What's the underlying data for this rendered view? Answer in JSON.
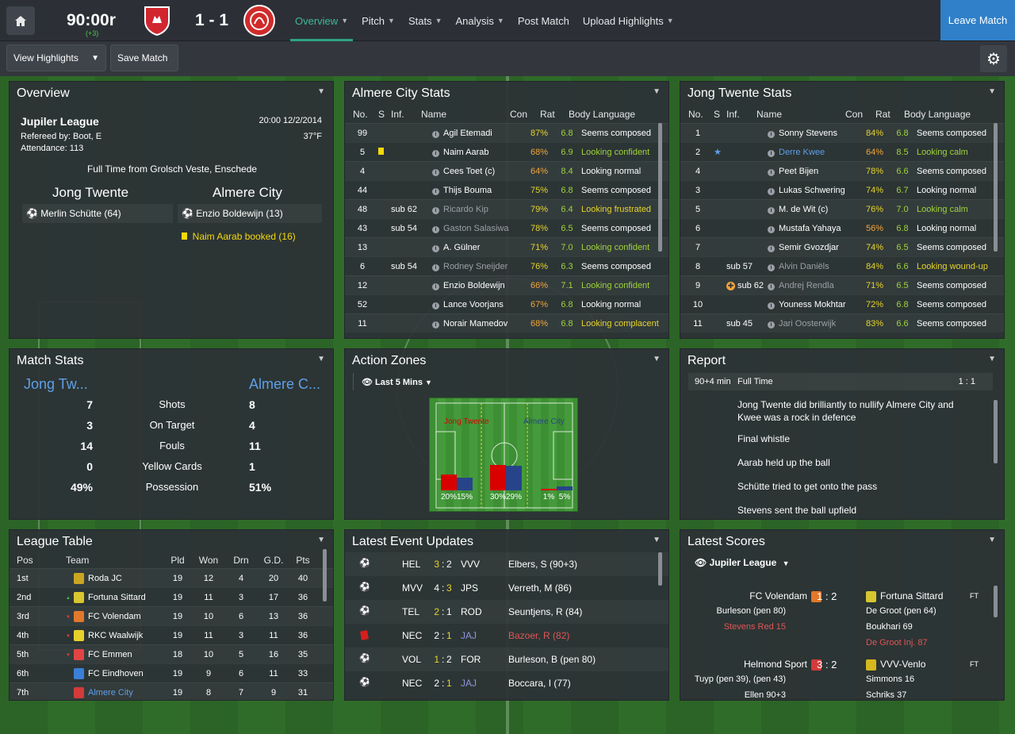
{
  "topbar": {
    "clock": "90:00r",
    "added_time": "(+3)",
    "score": "1 - 1",
    "home_color": "#d2262f",
    "away_color": "#d02b2b",
    "nav": [
      {
        "label": "Overview",
        "active": true
      },
      {
        "label": "Pitch"
      },
      {
        "label": "Stats"
      },
      {
        "label": "Analysis"
      },
      {
        "label": "Post Match"
      },
      {
        "label": "Upload Highlights"
      }
    ],
    "leave_label": "Leave Match"
  },
  "toolbar": {
    "highlights_label": "View Highlights",
    "save_label": "Save Match"
  },
  "overview": {
    "title": "Overview",
    "competition": "Jupiler League",
    "datetime": "20:00 12/2/2014",
    "referee": "Refereed by: Boot, E",
    "temperature": "37°F",
    "attendance": "Attendance: 113",
    "status": "Full Time from Grolsch Veste, Enschede",
    "home": "Jong Twente",
    "away": "Almere City",
    "home_events": [
      "Merlin Schütte (64)"
    ],
    "away_events": [
      "Enzio Boldewijn (13)",
      "Naim Aarab booked (16)"
    ]
  },
  "almere_stats": {
    "title": "Almere City Stats",
    "headers": [
      "No.",
      "S",
      "Inf.",
      "Name",
      "Con",
      "Rat",
      "Body Language"
    ],
    "rows": [
      {
        "no": "99",
        "inf": "",
        "name": "Agil Etemadi",
        "con": "87%",
        "rat": "6.8",
        "body": "Seems composed"
      },
      {
        "no": "5",
        "inf": "",
        "yellow": true,
        "name": "Naim Aarab",
        "con": "68%",
        "rat": "6.9",
        "body": "Looking confident"
      },
      {
        "no": "4",
        "inf": "",
        "name": "Cees Toet (c)",
        "con": "64%",
        "rat": "8.4",
        "body": "Looking normal"
      },
      {
        "no": "44",
        "inf": "",
        "name": "Thijs Bouma",
        "con": "75%",
        "rat": "6.8",
        "body": "Seems composed"
      },
      {
        "no": "48",
        "inf": "sub 62",
        "name": "Ricardo Kip",
        "con": "79%",
        "rat": "6.4",
        "body": "Looking frustrated"
      },
      {
        "no": "43",
        "inf": "sub 54",
        "name": "Gaston Salasiwa",
        "con": "78%",
        "rat": "6.5",
        "body": "Seems composed"
      },
      {
        "no": "13",
        "inf": "",
        "name": "A. Gülner",
        "con": "71%",
        "rat": "7.0",
        "body": "Looking confident"
      },
      {
        "no": "6",
        "inf": "sub 54",
        "name": "Rodney Sneijder",
        "con": "76%",
        "rat": "6.3",
        "body": "Seems composed"
      },
      {
        "no": "12",
        "inf": "",
        "name": "Enzio Boldewijn",
        "con": "66%",
        "rat": "7.1",
        "body": "Looking confident"
      },
      {
        "no": "52",
        "inf": "",
        "name": "Lance Voorjans",
        "con": "67%",
        "rat": "6.8",
        "body": "Looking normal"
      },
      {
        "no": "11",
        "inf": "",
        "name": "Norair Mamedov",
        "con": "68%",
        "rat": "6.8",
        "body": "Looking complacent"
      }
    ]
  },
  "twente_stats": {
    "title": "Jong Twente Stats",
    "headers": [
      "No.",
      "S",
      "Inf.",
      "Name",
      "Con",
      "Rat",
      "Body Language"
    ],
    "rows": [
      {
        "no": "1",
        "inf": "",
        "name": "Sonny Stevens",
        "con": "84%",
        "rat": "6.8",
        "body": "Seems composed"
      },
      {
        "no": "2",
        "inf": "",
        "star": true,
        "name": "Derre Kwee",
        "con": "64%",
        "rat": "8.5",
        "body": "Looking calm"
      },
      {
        "no": "4",
        "inf": "",
        "name": "Peet Bijen",
        "con": "78%",
        "rat": "6.6",
        "body": "Seems composed"
      },
      {
        "no": "3",
        "inf": "",
        "name": "Lukas Schwering",
        "con": "74%",
        "rat": "6.7",
        "body": "Looking normal"
      },
      {
        "no": "5",
        "inf": "",
        "name": "M. de Wit (c)",
        "con": "76%",
        "rat": "7.0",
        "body": "Looking calm"
      },
      {
        "no": "6",
        "inf": "",
        "name": "Mustafa Yahaya",
        "con": "56%",
        "rat": "6.8",
        "body": "Looking normal"
      },
      {
        "no": "7",
        "inf": "",
        "name": "Semir Gvozdjar",
        "con": "74%",
        "rat": "6.5",
        "body": "Seems composed"
      },
      {
        "no": "8",
        "inf": "sub 57",
        "name": "Alvin Daniëls",
        "con": "84%",
        "rat": "6.6",
        "body": "Looking wound-up"
      },
      {
        "no": "9",
        "inf": "sub 62",
        "injury": true,
        "name": "Andrej Rendla",
        "con": "71%",
        "rat": "6.5",
        "body": "Seems composed"
      },
      {
        "no": "10",
        "inf": "",
        "name": "Youness Mokhtar",
        "con": "72%",
        "rat": "6.8",
        "body": "Seems composed"
      },
      {
        "no": "11",
        "inf": "sub 45",
        "name": "Jari Oosterwijk",
        "con": "83%",
        "rat": "6.6",
        "body": "Seems composed"
      }
    ]
  },
  "match_stats": {
    "title": "Match Stats",
    "home": "Jong Tw...",
    "away": "Almere C...",
    "rows": [
      {
        "label": "Shots",
        "home": "7",
        "away": "8"
      },
      {
        "label": "On Target",
        "home": "3",
        "away": "4"
      },
      {
        "label": "Fouls",
        "home": "14",
        "away": "11"
      },
      {
        "label": "Yellow Cards",
        "home": "0",
        "away": "1"
      },
      {
        "label": "Possession",
        "home": "49%",
        "away": "51%"
      }
    ]
  },
  "action_zones": {
    "title": "Action Zones",
    "filter": "Last 5 Mins",
    "home": "Jong Twente",
    "away": "Almere City",
    "home_color": "#d90000",
    "away_color": "#27448a",
    "zones": [
      {
        "home": 20,
        "away": 15
      },
      {
        "home": 30,
        "away": 29
      },
      {
        "home": 1,
        "away": 5
      }
    ],
    "labels": [
      "20%",
      "15%",
      "30%",
      "29%",
      "1%",
      "5%"
    ]
  },
  "report": {
    "title": "Report",
    "time": "90+4 min",
    "event": "Full Time",
    "score": "1 : 1",
    "lines": [
      "Jong Twente did brilliantly to nullify Almere City and Kwee was a rock in defence",
      "Final whistle",
      "Aarab held up the ball",
      "Schütte tried to get onto the pass",
      "Stevens sent the ball upfield"
    ]
  },
  "league_table": {
    "title": "League Table",
    "headers": [
      "Pos",
      "Team",
      "Pld",
      "Won",
      "Drn",
      "G.D.",
      "Pts"
    ],
    "rows": [
      {
        "pos": "1st",
        "move": "",
        "team": "Roda JC",
        "badge": "#c9a522",
        "pld": "19",
        "won": "12",
        "drn": "4",
        "gd": "20",
        "pts": "40"
      },
      {
        "pos": "2nd",
        "move": "up",
        "team": "Fortuna Sittard",
        "badge": "#d7c62f",
        "pld": "19",
        "won": "11",
        "drn": "3",
        "gd": "17",
        "pts": "36"
      },
      {
        "pos": "3rd",
        "move": "down",
        "team": "FC Volendam",
        "badge": "#e2782b",
        "pld": "19",
        "won": "10",
        "drn": "6",
        "gd": "13",
        "pts": "36"
      },
      {
        "pos": "4th",
        "move": "down",
        "team": "RKC Waalwijk",
        "badge": "#e8d02a",
        "pld": "19",
        "won": "11",
        "drn": "3",
        "gd": "11",
        "pts": "36"
      },
      {
        "pos": "5th",
        "move": "down",
        "team": "FC Emmen",
        "badge": "#e24444",
        "pld": "18",
        "won": "10",
        "drn": "5",
        "gd": "16",
        "pts": "35"
      },
      {
        "pos": "6th",
        "move": "",
        "team": "FC Eindhoven",
        "badge": "#3a7fd8",
        "pld": "19",
        "won": "9",
        "drn": "6",
        "gd": "11",
        "pts": "33"
      },
      {
        "pos": "7th",
        "move": "",
        "team": "Almere City",
        "badge": "#d33a3a",
        "pld": "19",
        "won": "8",
        "drn": "7",
        "gd": "9",
        "pts": "31"
      }
    ]
  },
  "events": {
    "title": "Latest Event Updates",
    "rows": [
      {
        "icon": "ball",
        "home": "HEL",
        "hs": "3",
        "as": "2",
        "hl": "home",
        "away": "VVV",
        "detail": "Elbers, S (90+3)",
        "red": false
      },
      {
        "icon": "ball",
        "home": "MVV",
        "hs": "4",
        "as": "3",
        "hl": "away",
        "away": "JPS",
        "detail": "Verreth, M (86)",
        "red": false
      },
      {
        "icon": "ball",
        "home": "TEL",
        "hs": "2",
        "as": "1",
        "hl": "home",
        "away": "ROD",
        "detail": "Seuntjens, R (84)",
        "red": false
      },
      {
        "icon": "red",
        "home": "NEC",
        "hs": "2",
        "as": "1",
        "hl": "away",
        "away": "JAJ",
        "detail": "Bazoer, R (82)",
        "red": true
      },
      {
        "icon": "ball",
        "home": "VOL",
        "hs": "1",
        "as": "2",
        "hl": "home",
        "away": "FOR",
        "detail": "Burleson, B (pen 80)",
        "red": false
      },
      {
        "icon": "ball",
        "home": "NEC",
        "hs": "2",
        "as": "1",
        "hl": "away",
        "away": "JAJ",
        "detail": "Boccara, I (77)",
        "red": false
      }
    ]
  },
  "scores": {
    "title": "Latest Scores",
    "filter": "Jupiler League",
    "matches": [
      {
        "home": "FC Volendam",
        "home_badge": "#e2782b",
        "score": "1 : 2",
        "away": "Fortuna Sittard",
        "away_badge": "#d7c62f",
        "status": "FT",
        "home_notes": [
          {
            "text": "Burleson (pen 80)",
            "red": false
          },
          {
            "text": "Stevens Red 15",
            "red": true
          }
        ],
        "away_notes": [
          {
            "text": "De Groot (pen 64)",
            "red": false
          },
          {
            "text": "Boukhari 69",
            "red": false
          },
          {
            "text": "De Groot Inj. 87",
            "red": true
          }
        ]
      },
      {
        "home": "Helmond Sport",
        "home_badge": "#d33a3a",
        "score": "3 : 2",
        "away": "VVV-Venlo",
        "away_badge": "#d6b81e",
        "status": "FT",
        "home_notes": [
          {
            "text": "Tuyp (pen 39), (pen 43)",
            "red": false
          },
          {
            "text": "Ellen 90+3",
            "red": false
          }
        ],
        "away_notes": [
          {
            "text": "Simmons 16",
            "red": false
          },
          {
            "text": "Schriks 37",
            "red": false
          }
        ]
      }
    ]
  }
}
